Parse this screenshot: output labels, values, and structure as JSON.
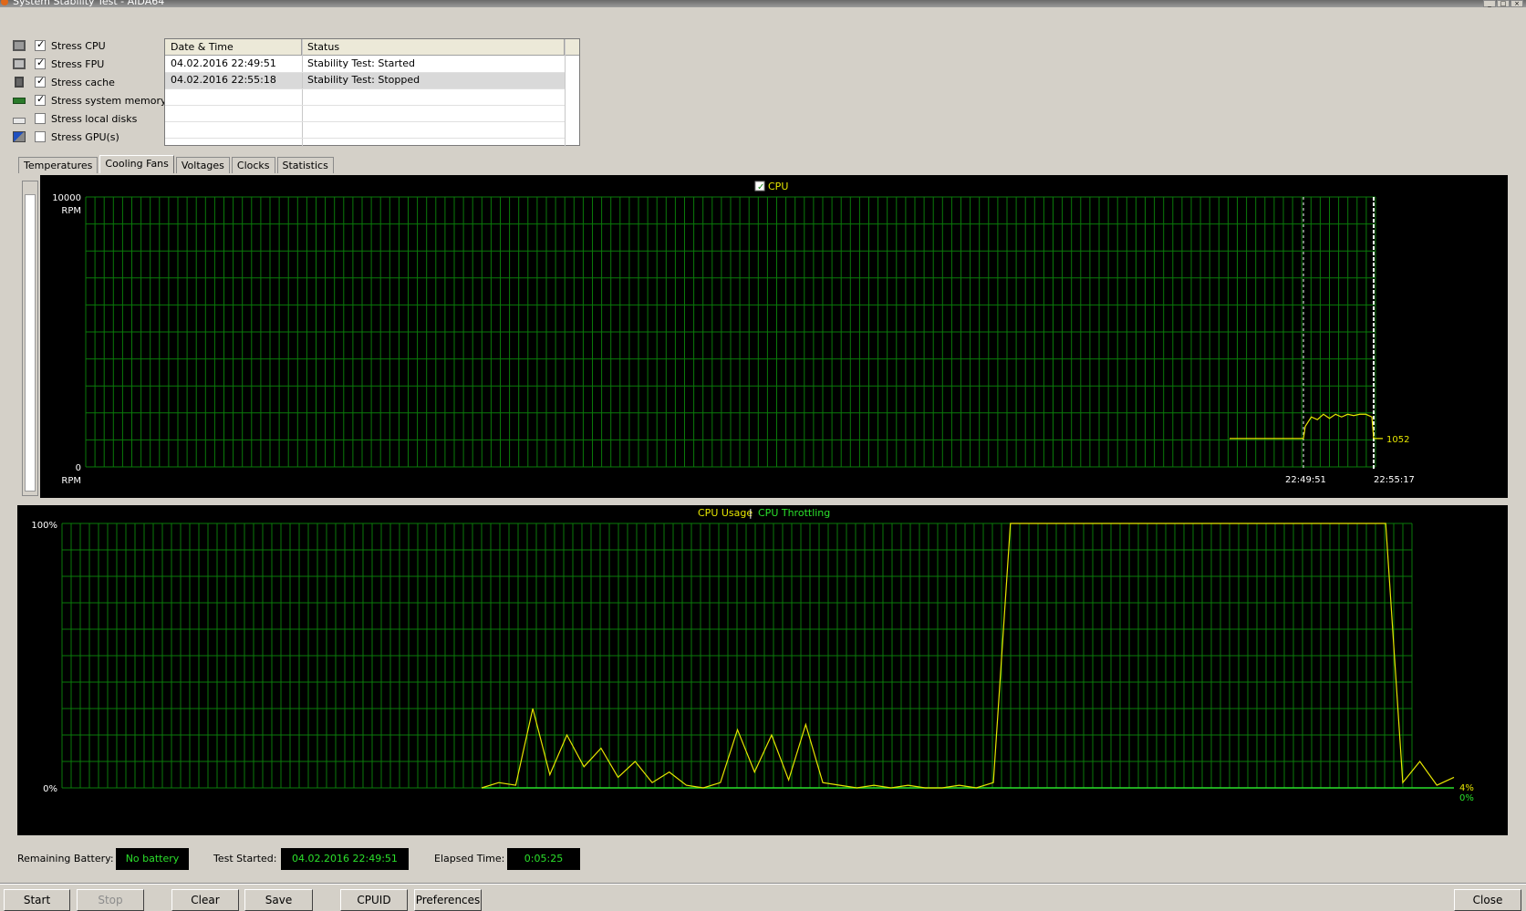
{
  "window": {
    "title": "System Stability Test - AIDA64"
  },
  "stress_options": [
    {
      "label": "Stress CPU",
      "checked": true,
      "icon": "cpu-chip-icon"
    },
    {
      "label": "Stress FPU",
      "checked": true,
      "icon": "fpu-chip-icon"
    },
    {
      "label": "Stress cache",
      "checked": true,
      "icon": "cache-chip-icon"
    },
    {
      "label": "Stress system memory",
      "checked": true,
      "icon": "memory-module-icon"
    },
    {
      "label": "Stress local disks",
      "checked": false,
      "icon": "hard-disk-icon"
    },
    {
      "label": "Stress GPU(s)",
      "checked": false,
      "icon": "gpu-monitor-icon"
    }
  ],
  "log": {
    "columns": [
      "Date & Time",
      "Status"
    ],
    "rows": [
      [
        "04.02.2016 22:49:51",
        "Stability Test: Started"
      ],
      [
        "04.02.2016 22:55:18",
        "Stability Test: Stopped"
      ]
    ]
  },
  "tabs": [
    "Temperatures",
    "Cooling Fans",
    "Voltages",
    "Clocks",
    "Statistics"
  ],
  "active_tab": "Cooling Fans",
  "fan_graph": {
    "legend": "CPU",
    "y_max_label": "10000",
    "y_min_label": "0",
    "y_unit": "RPM",
    "current_value_label": "1052",
    "time_start": "22:49:51",
    "time_end": "22:55:17",
    "line_color": "#e6e600"
  },
  "usage_graph": {
    "legend_usage": "CPU Usage",
    "legend_separator": "|",
    "legend_throttling": "CPU Throttling",
    "y_max_label": "100%",
    "y_min_label": "0%",
    "usage_value_label": "4%",
    "throttling_value_label": "0%",
    "usage_color": "#e6e600",
    "throttling_color": "#2be02b"
  },
  "status": {
    "battery_label": "Remaining Battery:",
    "battery_value": "No battery",
    "started_label": "Test Started:",
    "started_value": "04.02.2016 22:49:51",
    "elapsed_label": "Elapsed Time:",
    "elapsed_value": "0:05:25"
  },
  "buttons": {
    "start": "Start",
    "stop": "Stop",
    "clear": "Clear",
    "save": "Save",
    "cpuid": "CPUID",
    "preferences": "Preferences",
    "close": "Close"
  },
  "chart_data": [
    {
      "type": "line",
      "title": "",
      "series": [
        {
          "name": "CPU",
          "unit": "RPM",
          "x": [
            "22:49:51",
            "22:49:55",
            "22:50:10",
            "22:50:30",
            "22:51:00",
            "22:51:30",
            "22:52:00",
            "22:52:30",
            "22:53:00",
            "22:53:30",
            "22:54:00",
            "22:54:30",
            "22:55:00",
            "22:55:17"
          ],
          "values": [
            1052,
            1500,
            1850,
            1750,
            1950,
            1800,
            1950,
            1850,
            1950,
            1900,
            1950,
            1950,
            1850,
            1052
          ]
        }
      ],
      "ylabel": "RPM",
      "ylim": [
        0,
        10000
      ],
      "grid": true,
      "legend": "top-center"
    },
    {
      "type": "line",
      "title": "",
      "series": [
        {
          "name": "CPU Usage",
          "values": [
            0,
            2,
            1,
            30,
            5,
            20,
            8,
            15,
            4,
            10,
            2,
            6,
            1,
            0,
            2,
            22,
            6,
            20,
            3,
            24,
            2,
            1,
            0,
            1,
            0,
            1,
            0,
            0,
            1,
            0,
            2,
            100,
            100,
            100,
            100,
            100,
            100,
            100,
            100,
            100,
            100,
            100,
            100,
            100,
            100,
            100,
            100,
            100,
            100,
            100,
            100,
            100,
            100,
            100,
            2,
            10,
            1,
            4
          ]
        },
        {
          "name": "CPU Throttling",
          "values": [
            0,
            0,
            0,
            0,
            0,
            0,
            0,
            0,
            0,
            0,
            0,
            0,
            0,
            0,
            0,
            0,
            0,
            0,
            0,
            0,
            0,
            0,
            0,
            0,
            0,
            0,
            0,
            0,
            0,
            0,
            0,
            0,
            0,
            0,
            0,
            0,
            0,
            0,
            0,
            0,
            0,
            0,
            0,
            0,
            0,
            0,
            0,
            0,
            0,
            0,
            0,
            0,
            0,
            0,
            0,
            0,
            0,
            0
          ]
        }
      ],
      "ylim": [
        0,
        100
      ],
      "grid": true,
      "legend": "top-center"
    }
  ]
}
